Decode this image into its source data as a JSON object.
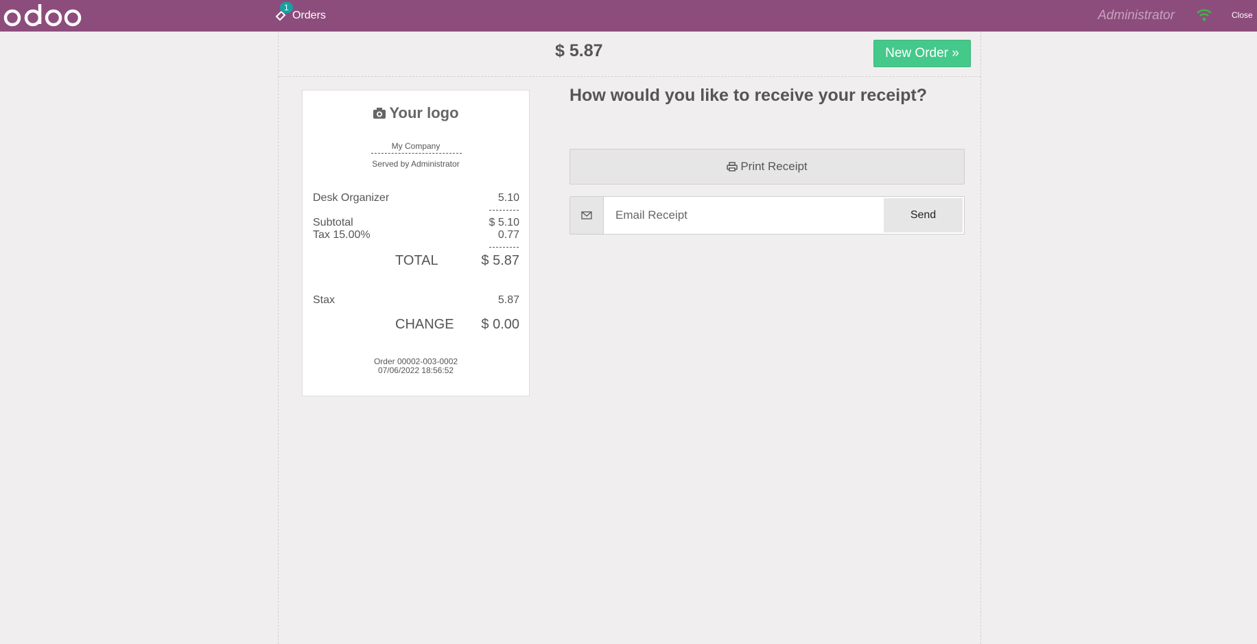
{
  "header": {
    "brand": "odoo",
    "orders_label": "Orders",
    "orders_badge": "1",
    "user": "Administrator",
    "close_label": "Close"
  },
  "order": {
    "total_display": "$ 5.87",
    "new_order_label": "New Order »"
  },
  "receipt": {
    "logo_text": "Your logo",
    "company": "My Company",
    "served_by": "Served by Administrator",
    "lines": [
      {
        "product": "Desk Organizer",
        "price": "5.10"
      }
    ],
    "subtotal_label": "Subtotal",
    "subtotal_value": "$ 5.10",
    "tax_label": "Tax 15.00%",
    "tax_value": "0.77",
    "total_label": "TOTAL",
    "total_value": "$ 5.87",
    "payment_label": "Stax",
    "payment_value": "5.87",
    "change_label": "CHANGE",
    "change_value": "$ 0.00",
    "order_ref": "Order 00002-003-0002",
    "datetime": "07/06/2022 18:56:52"
  },
  "receipt_options": {
    "question": "How would you like to receive your receipt?",
    "print_label": "Print Receipt",
    "email_placeholder": "Email Receipt",
    "send_label": "Send"
  },
  "colors": {
    "navbar": "#8d4d7c",
    "accent_green": "#45c98b",
    "badge": "#17a2a0",
    "background": "#f0eeee"
  }
}
